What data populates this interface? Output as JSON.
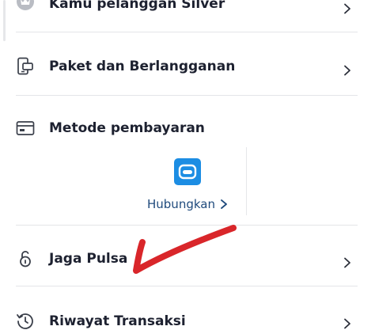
{
  "menu": {
    "items": [
      {
        "label": "Kamu pelanggan Silver",
        "icon": "crown-icon"
      },
      {
        "label": "Paket dan Berlangganan",
        "icon": "subscription-device-icon"
      },
      {
        "label": "Metode pembayaran",
        "icon": "payment-card-icon"
      },
      {
        "label": "Jaga Pulsa",
        "icon": "unlocked-lock-icon"
      },
      {
        "label": "Riwayat Transaksi",
        "icon": "history-clock-icon"
      }
    ]
  },
  "payment": {
    "connect_label": "Hubungkan",
    "wallet_icon": "e-wallet-icon",
    "wallet_color": "#1c8de3",
    "link_color": "#1f4a7c"
  },
  "annotation": {
    "color": "#d9262a"
  }
}
